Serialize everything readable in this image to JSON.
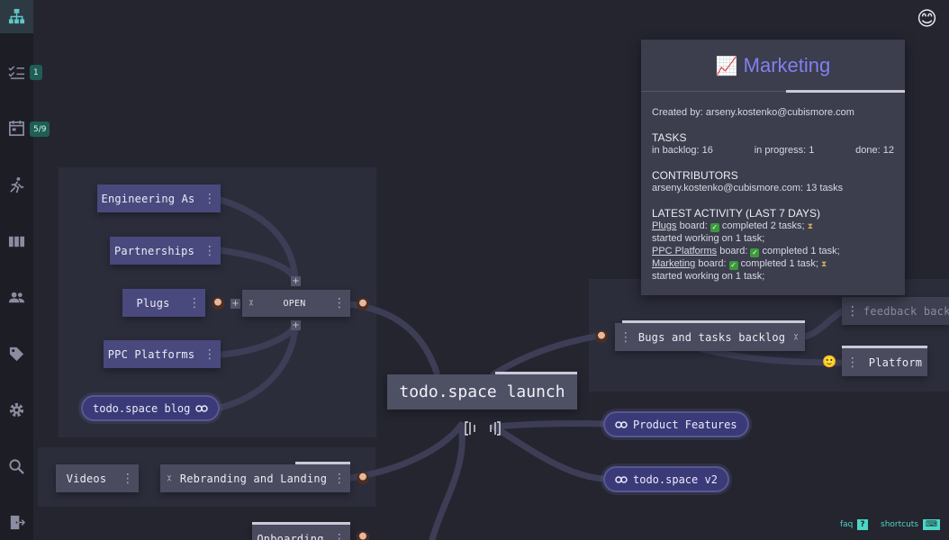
{
  "sidebar": {
    "items": [
      {
        "name": "boards",
        "icon": "hierarchy-icon",
        "active": true
      },
      {
        "name": "tasks",
        "icon": "checklist-icon",
        "badge": "1"
      },
      {
        "name": "calendar",
        "icon": "calendar-icon",
        "badge": "5/9"
      },
      {
        "name": "activity",
        "icon": "running-person-icon"
      },
      {
        "name": "kanban",
        "icon": "columns-icon"
      },
      {
        "name": "team",
        "icon": "people-icon"
      },
      {
        "name": "tags",
        "icon": "tag-icon"
      },
      {
        "name": "settings",
        "icon": "gear-icon"
      },
      {
        "name": "search",
        "icon": "search-icon"
      },
      {
        "name": "logout",
        "icon": "door-exit-icon"
      }
    ]
  },
  "top_right_emoji": "😊",
  "nodes": {
    "engineering": "Engineering As",
    "partnerships": "Partnerships",
    "plugs": "Plugs",
    "open": "OPEN",
    "ppc": "PPC Platforms",
    "blog": "todo.space blog",
    "videos": "Videos",
    "rebranding": "Rebranding and Landing",
    "onboarding": "Onboarding",
    "root": "todo.space launch",
    "bugs": "Bugs and tasks backlog",
    "feedback": "feedback back",
    "platform": "Platform",
    "product_features": "Product Features",
    "v2": "todo.space v2"
  },
  "popup": {
    "emoji": "📈",
    "title": "Marketing",
    "created_by": "Created by: arseny.kostenko@cubismore.com",
    "tasks_title": "TASKS",
    "backlog": "in backlog: 16",
    "in_progress": "in progress: 1",
    "done": "done: 12",
    "contributors_title": "CONTRIBUTORS",
    "contributor": "arseny.kostenko@cubismore.com: 13 tasks",
    "activity_title": "LATEST ACTIVITY (LAST 7 DAYS)",
    "a1_board": "Plugs",
    "a1_text": " board: ",
    "a1_completed": "completed 2 tasks;",
    "a1_started": "started working on 1 task;",
    "a2_board": "PPC Platforms",
    "a2_text": " board: ",
    "a2_completed": "completed 1 task;",
    "a3_board": "Marketing",
    "a3_text": " board: ",
    "a3_completed": "completed 1 task;",
    "a3_started": "started working on 1 task;"
  },
  "footer": {
    "faq": "faq",
    "faq_key": "?",
    "shortcuts": "shortcuts",
    "shortcuts_key": "⌨"
  },
  "colors": {
    "background": "#252530",
    "node_purple": "#49497e",
    "accent_title": "#8080f0",
    "badge": "#1f5d55",
    "footer_accent": "#4bd6c6"
  }
}
